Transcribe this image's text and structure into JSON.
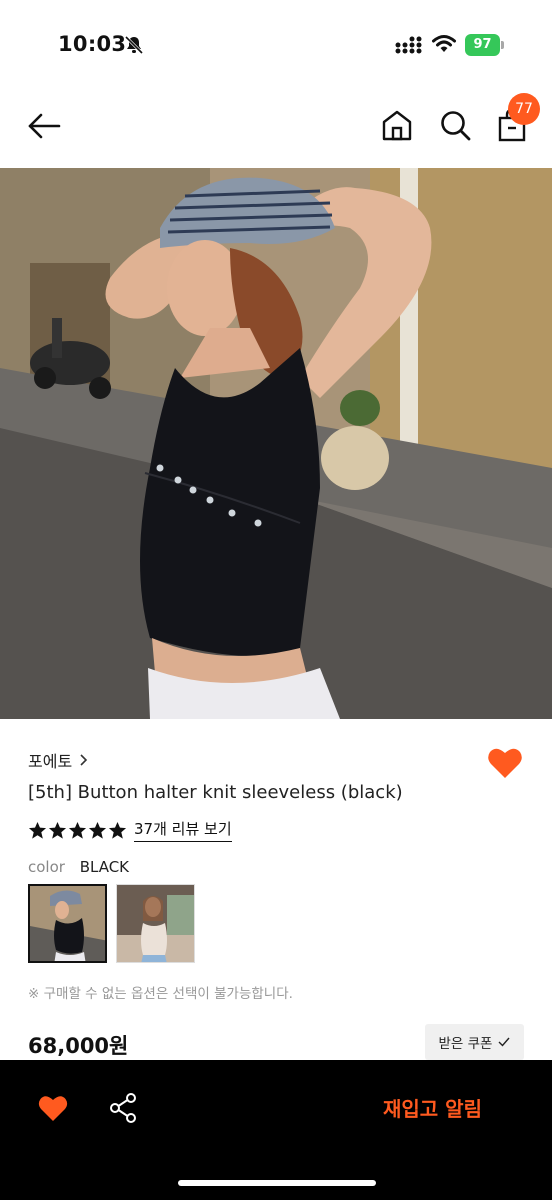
{
  "status_bar": {
    "time": "10:03",
    "battery": "97"
  },
  "nav": {
    "cart_count": "77"
  },
  "product": {
    "brand": "포에토",
    "title": "[5th] Button halter knit sleeveless (black)",
    "rating_stars": 5,
    "review_link": "37개 리뷰 보기",
    "color_label": "color",
    "color_value": "BLACK",
    "notice": "※ 구매할 수 없는 옵션은 선택이 불가능합니다.",
    "price": "68,000원",
    "coupon_label": "받은 쿠폰"
  },
  "bottom_bar": {
    "restock_label": "재입고 알림"
  },
  "colors": {
    "accent": "#ff5a1f",
    "battery": "#35c759"
  },
  "icons": [
    "bell-off-icon",
    "signal-icon",
    "wifi-icon",
    "back-arrow-icon",
    "home-icon",
    "search-icon",
    "shopping-bag-icon",
    "heart-icon",
    "chevron-right-icon",
    "star-icon",
    "check-icon",
    "share-icon"
  ]
}
